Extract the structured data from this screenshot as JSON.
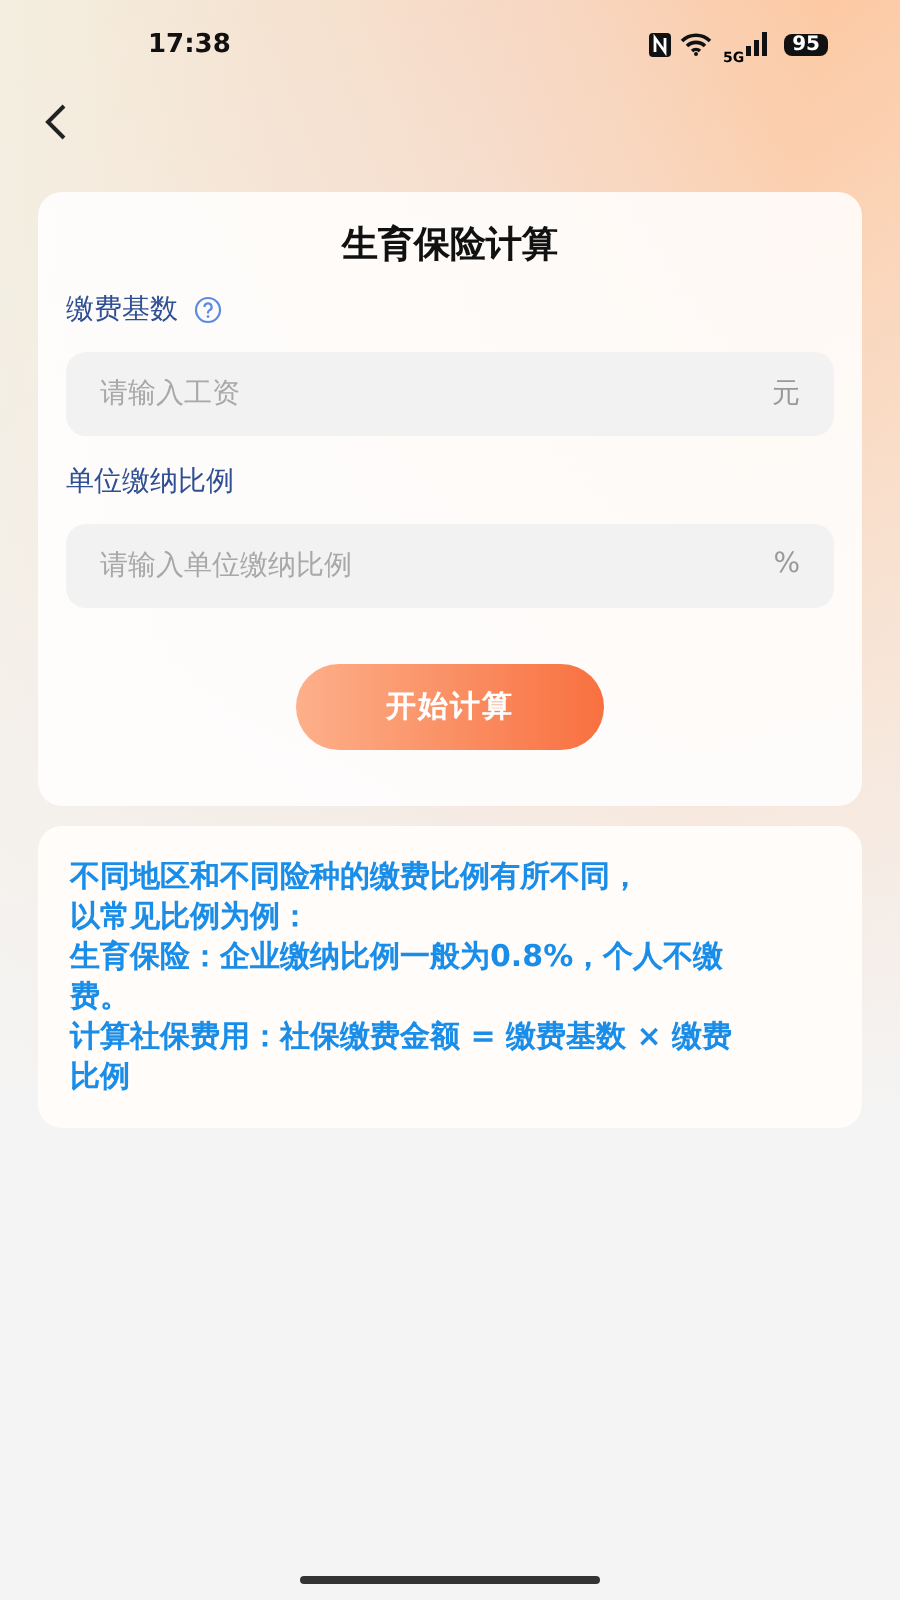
{
  "status_bar": {
    "time": "17:38",
    "network": "5G",
    "battery": "95"
  },
  "title": "生育保险计算",
  "fields": [
    {
      "label": "缴费基数",
      "has_help": true,
      "placeholder": "请输入工资",
      "unit": "元"
    },
    {
      "label": "单位缴纳比例",
      "has_help": false,
      "placeholder": "请输入单位缴纳比例",
      "unit": "%"
    }
  ],
  "button": "开始计算",
  "notes": [
    "不同地区和不同险种的缴费比例有所不同，",
    "以常见比例为例：",
    "生育保险：企业缴纳比例一般为0.8%，个人不缴费。",
    "计算社保费用：社保缴费金额 = 缴费基数 × 缴费比例"
  ]
}
